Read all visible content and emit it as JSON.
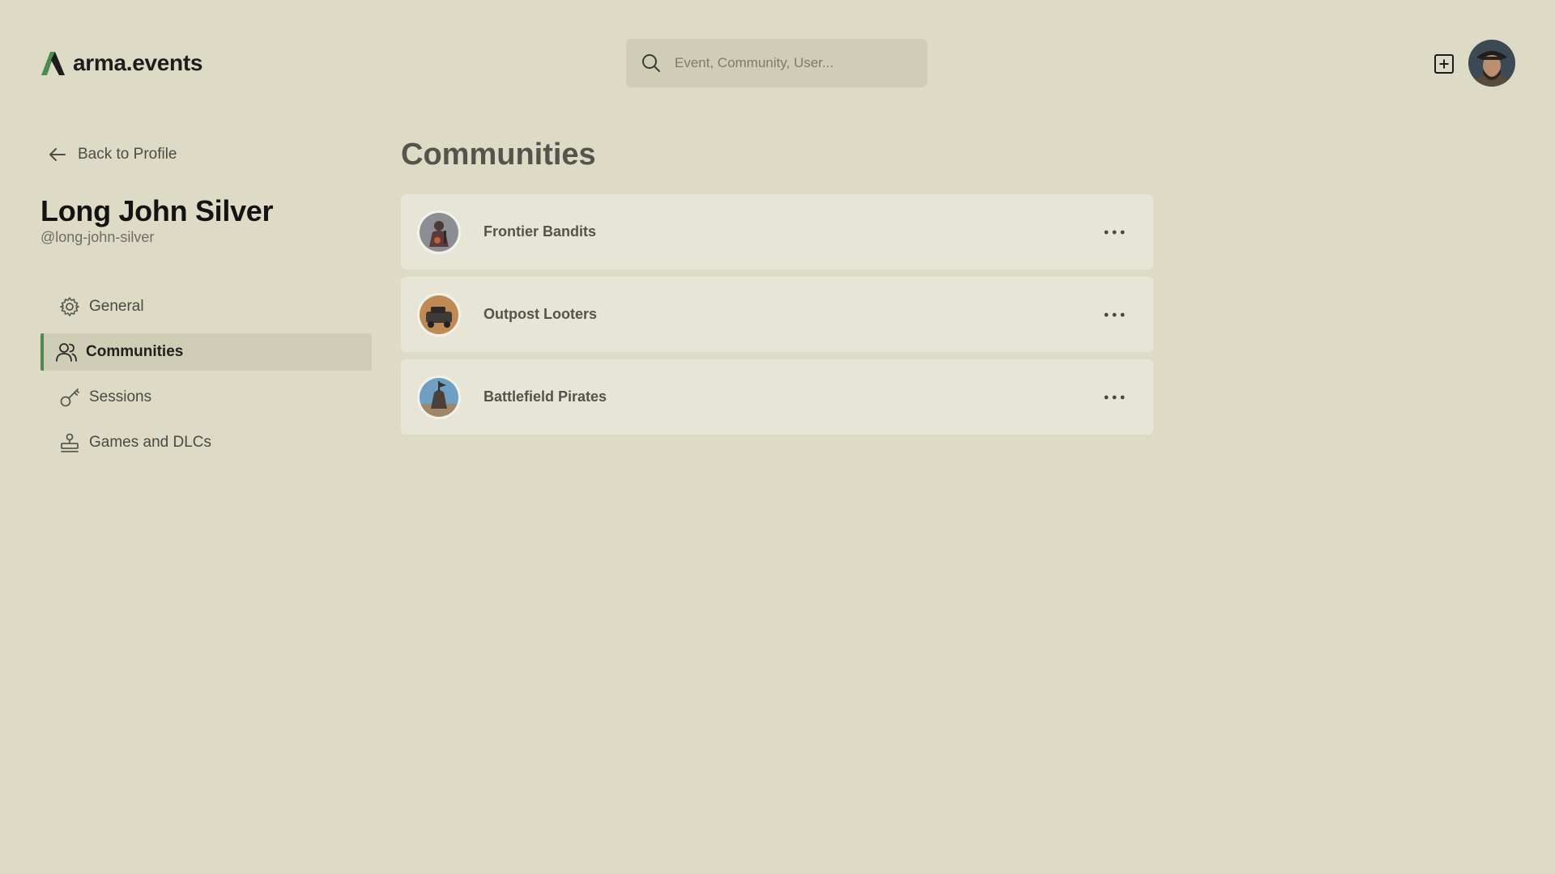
{
  "header": {
    "logo_text": "arma.events",
    "search_placeholder": "Event, Community, User...",
    "accent_color": "#4f8a55"
  },
  "sidebar": {
    "back_label": "Back to Profile",
    "profile_name": "Long John Silver",
    "profile_handle": "@long-john-silver",
    "items": [
      {
        "label": "General",
        "icon": "gear-icon",
        "active": false
      },
      {
        "label": "Communities",
        "icon": "users-icon",
        "active": true
      },
      {
        "label": "Sessions",
        "icon": "key-icon",
        "active": false
      },
      {
        "label": "Games and DLCs",
        "icon": "stamp-icon",
        "active": false
      }
    ]
  },
  "main": {
    "title": "Communities",
    "communities": [
      {
        "name": "Frontier Bandits"
      },
      {
        "name": "Outpost Looters"
      },
      {
        "name": "Battlefield Pirates"
      }
    ]
  }
}
